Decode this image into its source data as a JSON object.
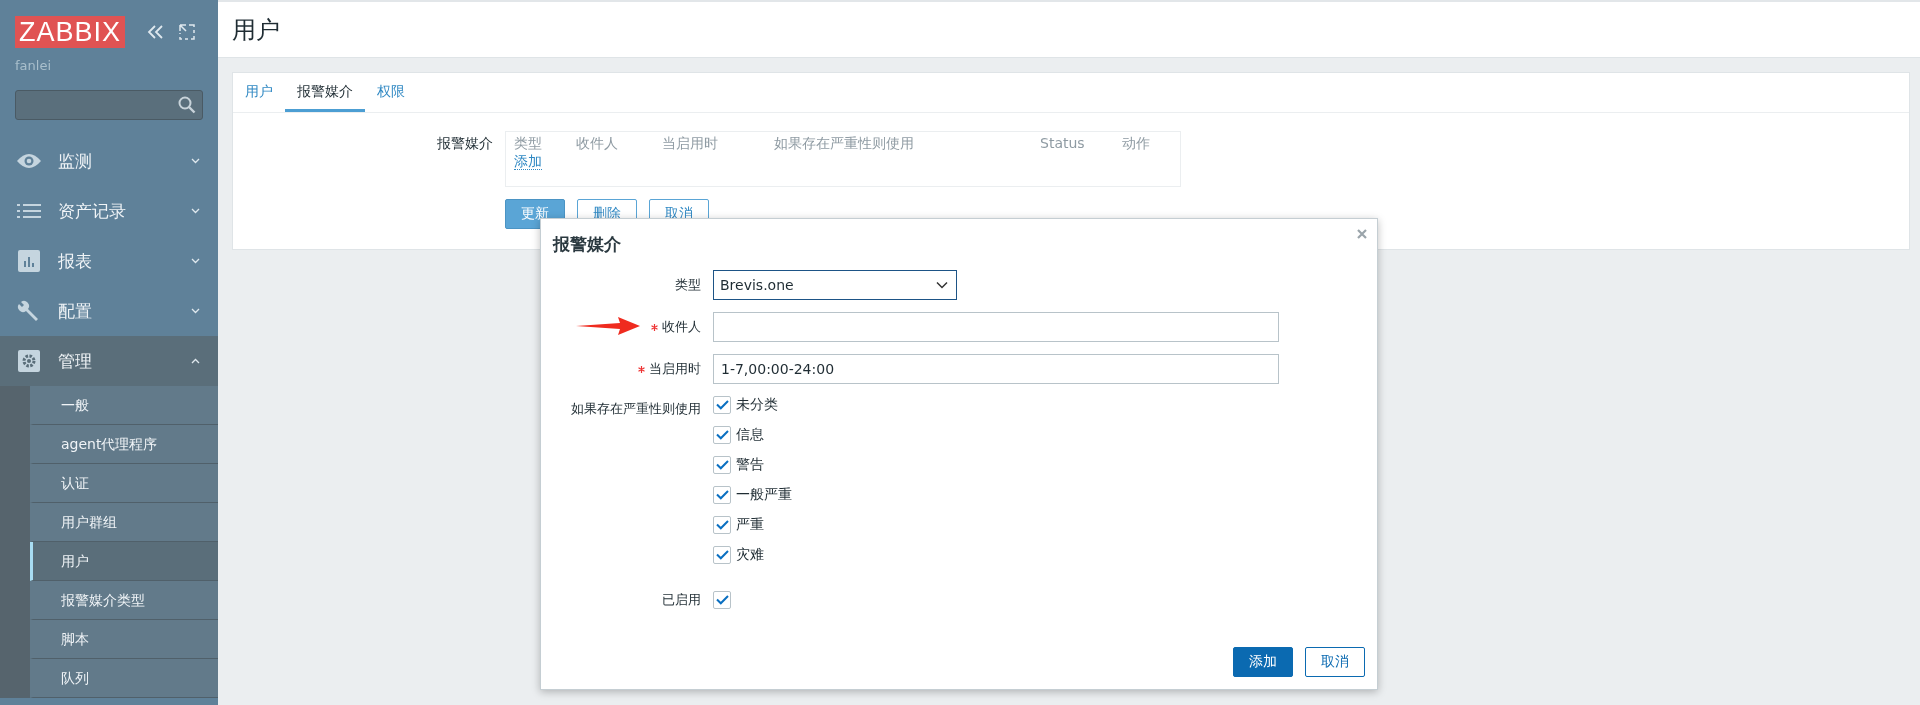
{
  "sidebar": {
    "logo": "ZABBIX",
    "user": "fanlei",
    "menu": [
      {
        "label": "监测",
        "expanded": false
      },
      {
        "label": "资产记录",
        "expanded": false
      },
      {
        "label": "报表",
        "expanded": false
      },
      {
        "label": "配置",
        "expanded": false
      },
      {
        "label": "管理",
        "expanded": true,
        "children": [
          {
            "label": "一般",
            "selected": false
          },
          {
            "label": "agent代理程序",
            "selected": false
          },
          {
            "label": "认证",
            "selected": false
          },
          {
            "label": "用户群组",
            "selected": false
          },
          {
            "label": "用户",
            "selected": true
          },
          {
            "label": "报警媒介类型",
            "selected": false
          },
          {
            "label": "脚本",
            "selected": false
          },
          {
            "label": "队列",
            "selected": false
          }
        ]
      }
    ]
  },
  "page_title": "用户",
  "tabs": [
    {
      "label": "用户",
      "selected": false
    },
    {
      "label": "报警媒介",
      "selected": true
    },
    {
      "label": "权限",
      "selected": false
    }
  ],
  "media": {
    "label": "报警媒介",
    "columns": [
      "类型",
      "收件人",
      "当启用时",
      "如果存在严重性则使用",
      "Status",
      "动作"
    ],
    "add_link": "添加"
  },
  "buttons": [
    {
      "label": "更新",
      "kind": "primary"
    },
    {
      "label": "删除",
      "kind": "secondary"
    },
    {
      "label": "取消",
      "kind": "secondary"
    }
  ],
  "dialog": {
    "title": "报警媒介",
    "type_field": {
      "label": "类型",
      "value": "Brevis.one"
    },
    "recipient_field": {
      "label": "收件人",
      "required": true
    },
    "period_field": {
      "label": "当启用时",
      "required": true,
      "value": "1-7,00:00-24:00"
    },
    "severity_label": "如果存在严重性则使用",
    "severities": [
      {
        "label": "未分类",
        "checked": true
      },
      {
        "label": "信息",
        "checked": true
      },
      {
        "label": "警告",
        "checked": true
      },
      {
        "label": "一般严重",
        "checked": true
      },
      {
        "label": "严重",
        "checked": true
      },
      {
        "label": "灾难",
        "checked": true
      }
    ],
    "enabled": {
      "label": "已启用",
      "checked": true
    },
    "buttons": [
      {
        "label": "添加",
        "kind": "primary"
      },
      {
        "label": "取消",
        "kind": "secondary"
      }
    ]
  }
}
